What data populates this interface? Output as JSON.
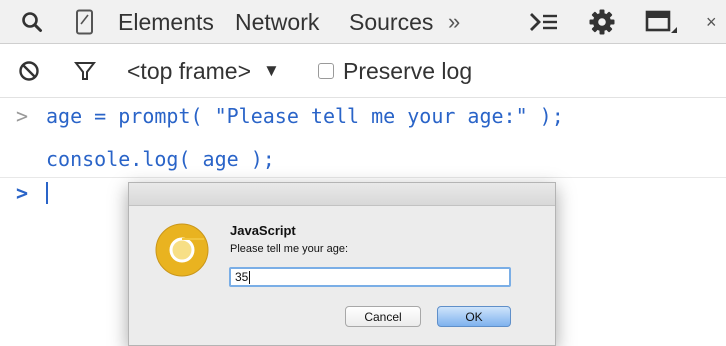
{
  "toolbar": {
    "tabs": [
      {
        "label": "Elements"
      },
      {
        "label": "Network"
      },
      {
        "label": "Sources"
      }
    ],
    "more": "»",
    "close": "×"
  },
  "filterbar": {
    "frame": "<top frame>",
    "dropdown": "▼",
    "preserve_log": "Preserve log",
    "preserve_log_checked": false
  },
  "console": {
    "lines": [
      {
        "prompt": ">",
        "code": "age = prompt( \"Please tell me your age:\" );"
      },
      {
        "prompt": "",
        "code": "console.log( age );"
      }
    ],
    "input_prompt": ">"
  },
  "dialog": {
    "title": "JavaScript",
    "message": "Please tell me your age:",
    "input_value": "35",
    "cancel": "Cancel",
    "ok": "OK"
  },
  "colors": {
    "code": "#2a64c8",
    "accent": "#5f8fc9"
  }
}
